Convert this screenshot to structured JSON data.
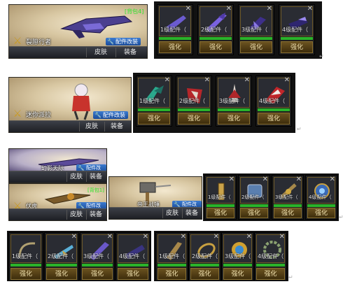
{
  "buttons": {
    "skin": "皮肤",
    "equip": "装备",
    "modify": "配件改装",
    "upgrade": "强化"
  },
  "groups": [
    {
      "weapon": {
        "name": "裂隙行者",
        "tag": "[背包4]"
      },
      "parts": [
        "1级配件（",
        "2级配件（",
        "3级配件（",
        "4级配件（"
      ]
    },
    {
      "weapon": {
        "name": "迷你派拉"
      },
      "parts": [
        "1级配件（",
        "2级配件（",
        "3级配件（",
        "4级配件（"
      ]
    },
    {
      "weapons": [
        {
          "name": "幻影天际",
          "tag": ""
        },
        {
          "name": "伏虎",
          "tag": "[背包1]"
        },
        {
          "name": "帝王战锤"
        }
      ],
      "parts": [
        "1级配件（",
        "2级配件（",
        "3级配件（",
        "4级配件（"
      ]
    },
    {
      "parts_a": [
        "1级配件（",
        "2级配件（",
        "3级配件（",
        "4级配件（"
      ],
      "parts_b": [
        "1级配件（",
        "2级配件（",
        "3级配件（",
        "4级配件（"
      ]
    }
  ],
  "icons": {
    "close": "close-icon",
    "emblem": "crossed-swords-emblem-icon",
    "wrench": "wrench-icon"
  },
  "colors": {
    "progress": "#2ab32a",
    "modify_button": "#2a64b8",
    "upgrade_button": "#5a451a",
    "tag": "#2ee62e"
  }
}
